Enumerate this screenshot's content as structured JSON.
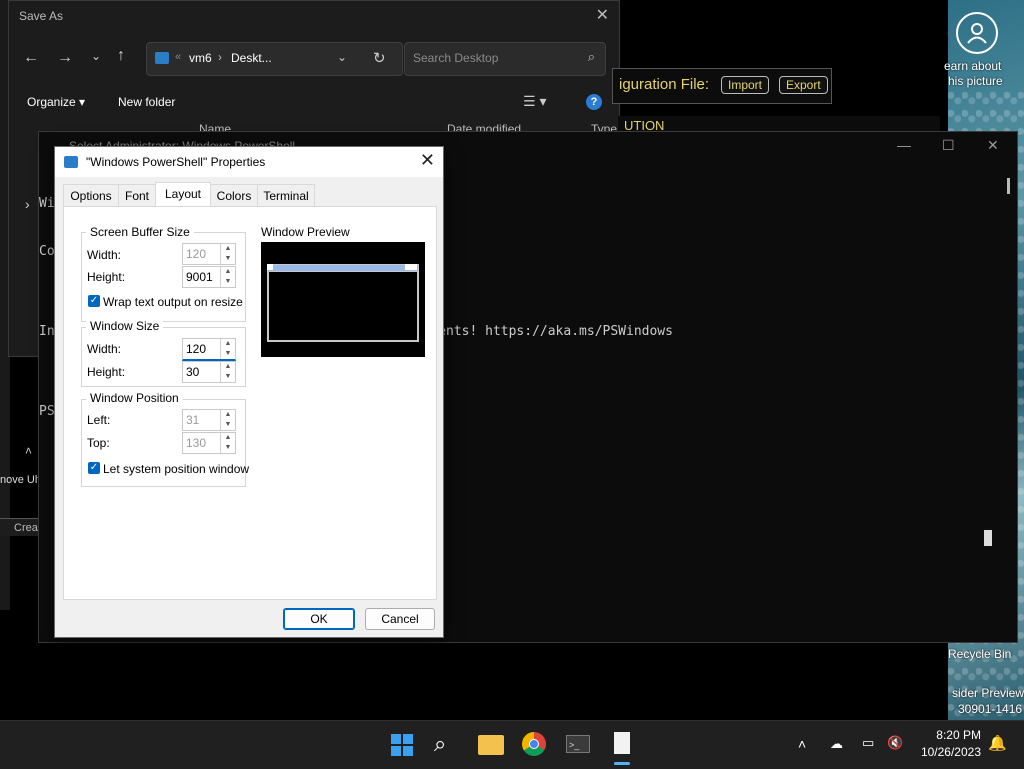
{
  "save_as": {
    "title": "Save As",
    "address_parts": [
      "vm6",
      "Deskt..."
    ],
    "search_placeholder": "Search Desktop",
    "organize_label": "Organize",
    "new_folder_label": "New folder",
    "columns": [
      "Name",
      "Date modified",
      "Type"
    ]
  },
  "powershell": {
    "title": "Select Administrator: Windows PowerShell",
    "lines": [
      "Wi",
      "Co                                         served.",
      "",
      "In                                         improvements! https://aka.ms/PSWindows",
      "",
      "PS"
    ],
    "config_label": "iguration File:",
    "import_label": "Import",
    "export_label": "Export",
    "caution_text": "UTION"
  },
  "dialog": {
    "title": "\"Windows PowerShell\" Properties",
    "tabs": [
      "Options",
      "Font",
      "Layout",
      "Colors",
      "Terminal"
    ],
    "active_tab": "Layout",
    "screen_buffer": {
      "label": "Screen Buffer Size",
      "width_label": "Width:",
      "width_value": "120",
      "height_label": "Height:",
      "height_value": "9001",
      "wrap_label": "Wrap text output on resize"
    },
    "window_size": {
      "label": "Window Size",
      "width_label": "Width:",
      "width_value": "120",
      "height_label": "Height:",
      "height_value": "30"
    },
    "window_position": {
      "label": "Window Position",
      "left_label": "Left:",
      "left_value": "31",
      "top_label": "Top:",
      "top_value": "130",
      "let_system_label": "Let system position window"
    },
    "preview_label": "Window Preview",
    "ok_label": "OK",
    "cancel_label": "Cancel"
  },
  "desktop": {
    "learn_about": "earn about",
    "this_picture": "his picture",
    "recycle_bin": "Recycle Bin",
    "insider_preview": "sider Preview",
    "build": "30901-1416"
  },
  "left_fragments": {
    "remove": "nove Ult",
    "create": "Crea"
  },
  "taskbar": {
    "time": "8:20 PM",
    "date": "10/26/2023"
  },
  "colors": {
    "accent": "#0067c0",
    "console_bg": "#0c0c0c",
    "button_text": "#e6d36a"
  }
}
